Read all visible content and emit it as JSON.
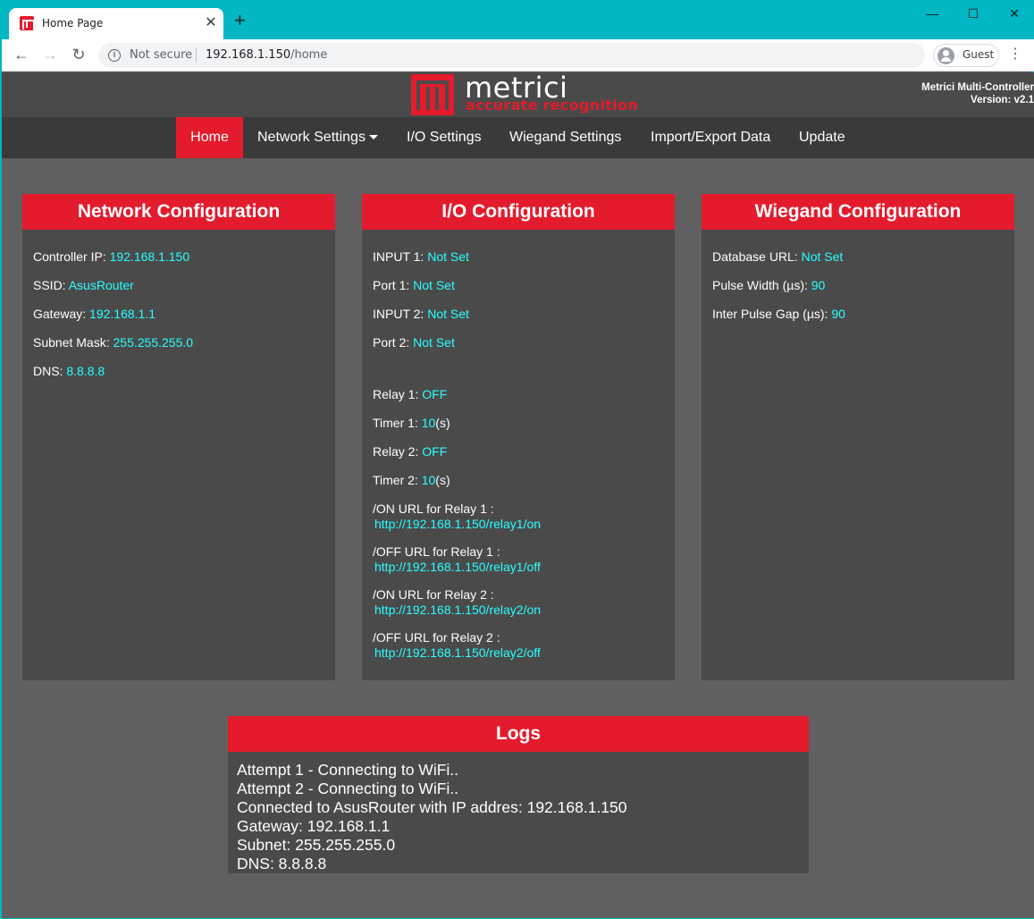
{
  "browser": {
    "tab_title": "Home Page",
    "new_tab": "+",
    "security_label": "Not secure",
    "url_host": "192.168.1.150",
    "url_path": "/home",
    "profile_label": "Guest"
  },
  "header": {
    "logo_name": "metrici",
    "logo_tagline": "accurate recognition",
    "product_name": "Metrici Multi-Controller",
    "version": "Version: v2.1"
  },
  "nav": {
    "items": [
      "Home",
      "Network Settings",
      "I/O Settings",
      "Wiegand Settings",
      "Import/Export Data",
      "Update"
    ],
    "active": "Home"
  },
  "network": {
    "title": "Network Configuration",
    "rows": [
      {
        "label": "Controller IP:",
        "value": "192.168.1.150"
      },
      {
        "label": "SSID:",
        "value": "AsusRouter"
      },
      {
        "label": "Gateway:",
        "value": "192.168.1.1"
      },
      {
        "label": "Subnet Mask:",
        "value": "255.255.255.0"
      },
      {
        "label": "DNS:",
        "value": "8.8.8.8"
      }
    ]
  },
  "io": {
    "title": "I/O Configuration",
    "inputs": [
      {
        "label": "INPUT 1:",
        "value": "Not Set"
      },
      {
        "label": "Port 1:",
        "value": "Not Set"
      },
      {
        "label": "INPUT 2:",
        "value": "Not Set"
      },
      {
        "label": "Port 2:",
        "value": "Not Set"
      }
    ],
    "relays": [
      {
        "label": "Relay 1:",
        "value": "OFF"
      },
      {
        "label": "Timer 1:",
        "value": "10",
        "unit": "(s)"
      },
      {
        "label": "Relay 2:",
        "value": "OFF"
      },
      {
        "label": "Timer 2:",
        "value": "10",
        "unit": "(s)"
      }
    ],
    "urls": [
      {
        "label": "/ON URL for Relay 1 :",
        "value": "http://192.168.1.150/relay1/on"
      },
      {
        "label": "/OFF URL for Relay 1 :",
        "value": "http://192.168.1.150/relay1/off"
      },
      {
        "label": "/ON URL for Relay 2 :",
        "value": "http://192.168.1.150/relay2/on"
      },
      {
        "label": "/OFF URL for Relay 2 :",
        "value": "http://192.168.1.150/relay2/off"
      }
    ]
  },
  "wiegand": {
    "title": "Wiegand Configuration",
    "rows": [
      {
        "label": "Database URL:",
        "value": "Not Set"
      },
      {
        "label": "Pulse Width (µs):",
        "value": "90"
      },
      {
        "label": "Inter Pulse Gap (µs):",
        "value": "90"
      }
    ]
  },
  "logs": {
    "title": "Logs",
    "lines": [
      "Attempt 1 - Connecting to WiFi..",
      "Attempt 2 - Connecting to WiFi..",
      "Connected to AsusRouter with IP addres: 192.168.1.150",
      "Gateway: 192.168.1.1",
      "Subnet: 255.255.255.0",
      "DNS: 8.8.8.8"
    ]
  },
  "colors": {
    "brand_red": "#e31b2c",
    "value_cyan": "#28ffff",
    "titlebar": "#00b7c3"
  }
}
